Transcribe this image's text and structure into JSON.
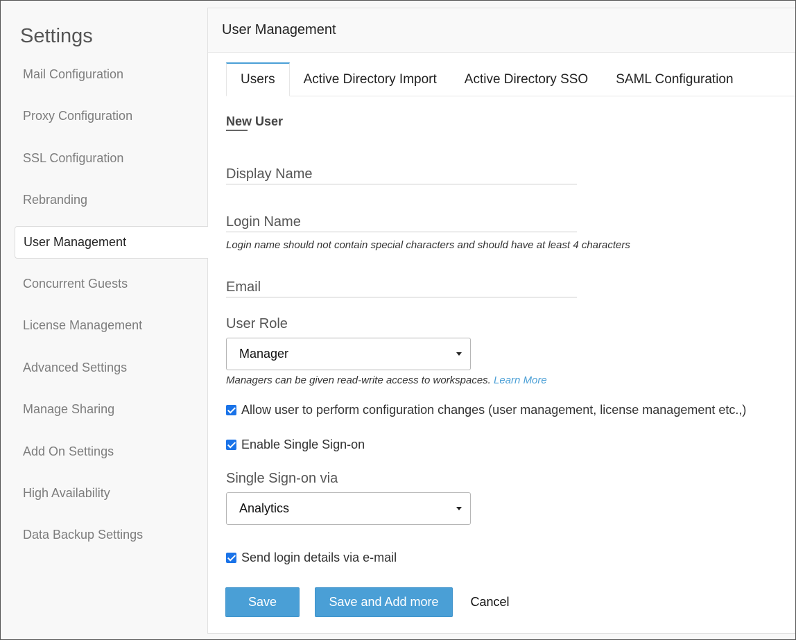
{
  "sidebar": {
    "title": "Settings",
    "items": [
      {
        "label": "Mail Configuration"
      },
      {
        "label": "Proxy Configuration"
      },
      {
        "label": "SSL Configuration"
      },
      {
        "label": "Rebranding"
      },
      {
        "label": "User Management"
      },
      {
        "label": "Concurrent Guests"
      },
      {
        "label": "License Management"
      },
      {
        "label": "Advanced Settings"
      },
      {
        "label": "Manage Sharing"
      },
      {
        "label": "Add On Settings"
      },
      {
        "label": "High Availability"
      },
      {
        "label": "Data Backup Settings"
      }
    ],
    "active_item": "User Management"
  },
  "panel": {
    "title": "User Management",
    "tabs": [
      {
        "label": "Users"
      },
      {
        "label": "Active Directory Import"
      },
      {
        "label": "Active Directory SSO"
      },
      {
        "label": "SAML Configuration"
      }
    ],
    "active_tab": "Users"
  },
  "form": {
    "section_title": "New User",
    "display_name": {
      "label": "Display Name",
      "value": ""
    },
    "login_name": {
      "label": "Login Name",
      "value": "",
      "hint": "Login name should not contain special characters and should have at least 4 characters"
    },
    "email": {
      "label": "Email",
      "value": ""
    },
    "user_role": {
      "label": "User Role",
      "selected": "Manager",
      "hint": "Managers can be given read-write access to workspaces.",
      "learn_more": "Learn More"
    },
    "allow_config": {
      "label": "Allow user to perform configuration changes (user management, license management etc.,)",
      "checked": true
    },
    "enable_sso": {
      "label": "Enable Single Sign-on",
      "checked": true
    },
    "sso_via": {
      "label": "Single Sign-on via",
      "selected": "Analytics"
    },
    "send_email": {
      "label": "Send login details via e-mail",
      "checked": true
    }
  },
  "buttons": {
    "save": "Save",
    "save_add_more": "Save and Add more",
    "cancel": "Cancel"
  },
  "colors": {
    "accent": "#4a9fd6",
    "checkbox": "#1a73e8"
  }
}
